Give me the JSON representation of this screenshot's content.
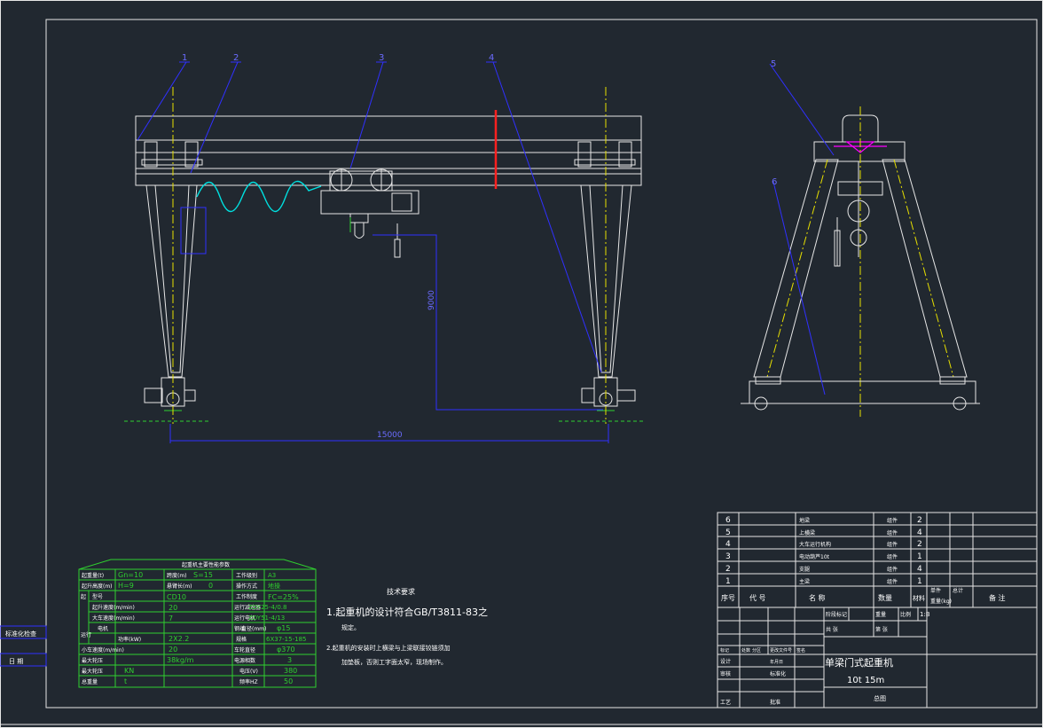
{
  "balloons": [
    "1",
    "2",
    "3",
    "4",
    "5",
    "6"
  ],
  "dims": {
    "height": "9000",
    "span": "15000"
  },
  "tech": {
    "title": "技术要求",
    "line1": "1.起重机的设计符合GB/T3811-83之",
    "line1b": "规定。",
    "line2": "2.起重机的安装时上横梁与上梁联接铰链须加",
    "line2b": "加垫板，否则工字面太窄，现场制作。"
  },
  "params": {
    "title": "起重机主要性能参数",
    "r1": [
      "起重量(t)",
      "Gn=10",
      "跨度(m)",
      "S=15",
      "工作级别",
      "A3"
    ],
    "r2": [
      "起升高度(m)",
      "H=9",
      "悬臂长(m)",
      "0",
      "操作方式",
      "地操"
    ],
    "r3": [
      "起",
      "型号",
      "CD10",
      "工作制度",
      "FC=25%"
    ],
    "r4": [
      "起升速度(m/min)",
      "20",
      "运行减速器",
      "ZDY25-4/0.8"
    ],
    "r5": [
      "大车速度(m/min)",
      "7",
      "运行电机",
      "ZDY51-4/13"
    ],
    "r6": [
      "运行",
      "电机",
      "功率(kW)",
      "2X2.2",
      "钢丝",
      "直径(mm)",
      "φ15"
    ],
    "r7": [
      "规格",
      "6X37-15-185"
    ],
    "r8": [
      "小车速度(m/min)",
      "20",
      "车轮直径",
      "φ370"
    ],
    "r9": [
      "最大轮压",
      "38kg/m",
      "电源",
      "相数",
      "3"
    ],
    "r10": [
      "最大轮压",
      "KN",
      "电压(V)",
      "380"
    ],
    "r11": [
      "总重量",
      "t",
      "频率HZ",
      "50"
    ]
  },
  "side": {
    "a": "标准化检查",
    "b": "日  期"
  },
  "bom": {
    "rows": [
      {
        "no": "6",
        "name": "地梁",
        "mat": "组件",
        "qty": "2"
      },
      {
        "no": "5",
        "name": "上横梁",
        "mat": "组件",
        "qty": "4"
      },
      {
        "no": "4",
        "name": "大车运行机构",
        "mat": "组件",
        "qty": "2"
      },
      {
        "no": "3",
        "name": "电动葫芦10t",
        "mat": "组件",
        "qty": "1"
      },
      {
        "no": "2",
        "name": "支腿",
        "mat": "组件",
        "qty": "4"
      },
      {
        "no": "1",
        "name": "主梁",
        "mat": "组件",
        "qty": "1"
      }
    ],
    "hdr": [
      "序号",
      "代  号",
      "名    称",
      "数量",
      "材料",
      "单件",
      "总计",
      "重量(kg)",
      "备  注"
    ]
  },
  "title_block": {
    "name": "单梁门式起重机",
    "spec": "10t    15m",
    "cells": [
      "标记",
      "处数",
      "分区",
      "更改文件号",
      "签名",
      "年月日",
      "设计",
      "标准化",
      "审核",
      "工艺",
      "批准",
      "阶段标记",
      "重量",
      "比例",
      "共 张",
      "第 张"
    ],
    "scale": "1:B",
    "drawing_no": "总图"
  }
}
